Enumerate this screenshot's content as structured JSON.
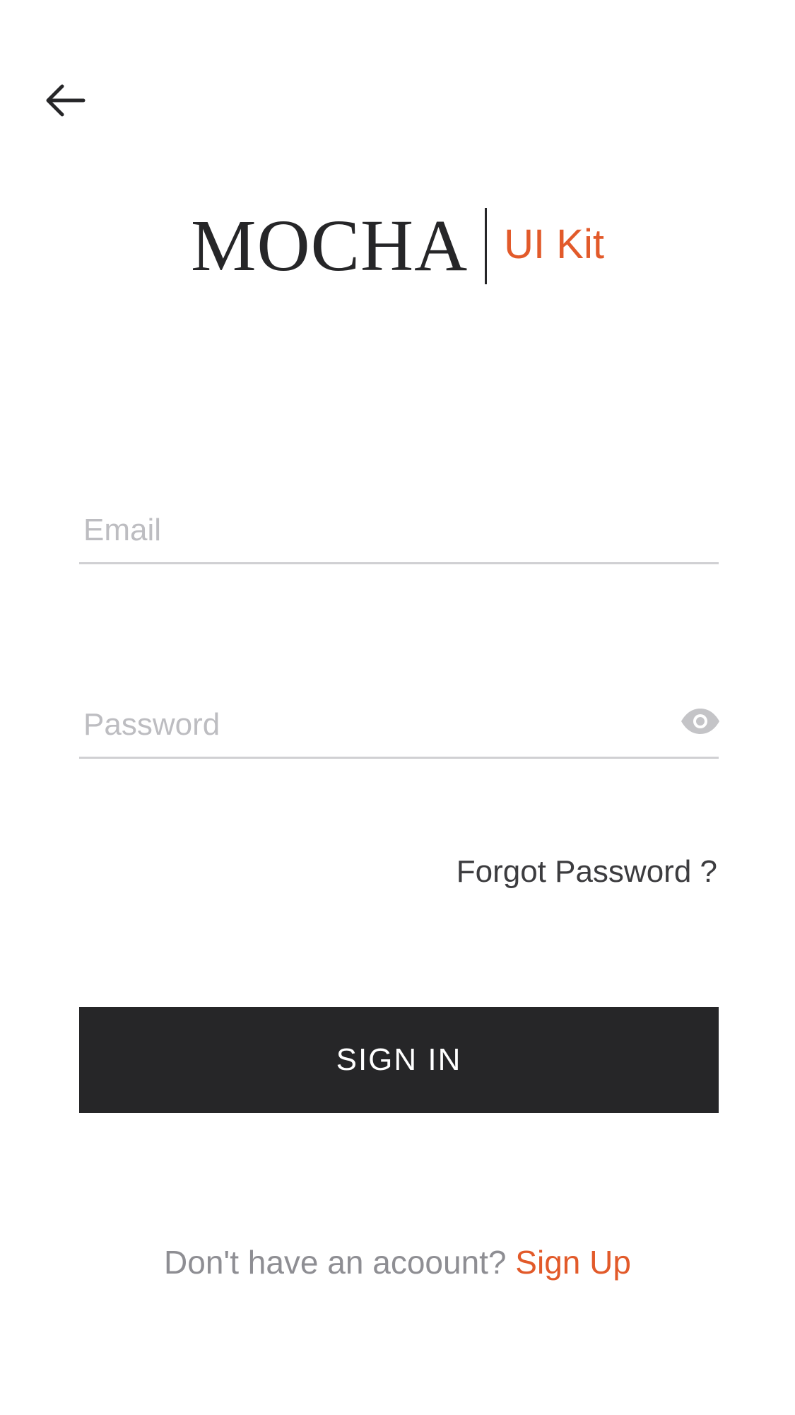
{
  "colors": {
    "accent": "#e25a2a",
    "primary_dark": "#262628",
    "placeholder": "#bdbdc1",
    "underline": "#d0d0d3",
    "muted_text": "#8e8e93"
  },
  "header": {
    "back_icon": "arrow-left-icon"
  },
  "logo": {
    "wordmark": "MOCHA",
    "subtitle": "UI Kit"
  },
  "form": {
    "email": {
      "placeholder": "Email",
      "value": ""
    },
    "password": {
      "placeholder": "Password",
      "value": "",
      "toggle_icon": "eye-icon"
    },
    "forgot_label": "Forgot Password ?",
    "submit_label": "SIGN IN"
  },
  "footer": {
    "prompt": "Don't have an acoount?",
    "signup_label": "Sign Up"
  }
}
